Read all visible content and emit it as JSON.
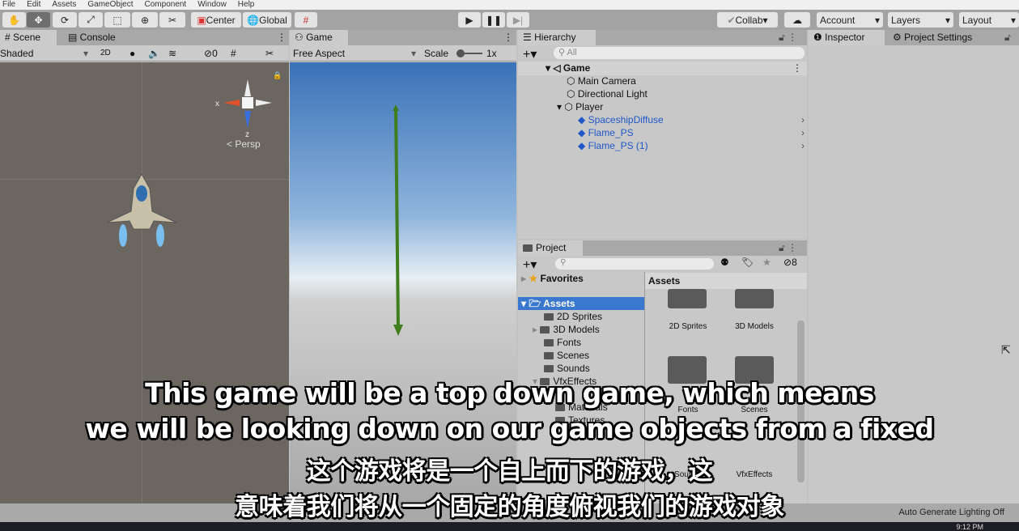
{
  "menu": [
    "File",
    "Edit",
    "Assets",
    "GameObject",
    "Component",
    "Window",
    "Help"
  ],
  "toolbar": {
    "tools": [
      "hand-icon",
      "move-icon",
      "rotate-icon",
      "scale-icon",
      "rect-icon",
      "transform-icon",
      "custom-tool-icon"
    ],
    "center": "Center",
    "global": "Global",
    "collab": "Collab",
    "account": "Account",
    "layers": "Layers",
    "layout": "Layout"
  },
  "scene": {
    "tab": "Scene",
    "console_tab": "Console",
    "shading": "Shaded",
    "mode2d": "2D",
    "hidden_count": "0",
    "gizmo_x": "x",
    "gizmo_z": "z",
    "persp": "Persp"
  },
  "game": {
    "tab": "Game",
    "aspect": "Free Aspect",
    "scale_label": "Scale",
    "scale_value": "1x"
  },
  "hierarchy": {
    "tab": "Hierarchy",
    "search_placeholder": "All",
    "scene": "Game",
    "items": [
      {
        "label": "Main Camera"
      },
      {
        "label": "Directional Light"
      },
      {
        "label": "Player"
      },
      {
        "label": "SpaceshipDiffuse"
      },
      {
        "label": "Flame_PS"
      },
      {
        "label": "Flame_PS (1)"
      }
    ]
  },
  "project": {
    "tab": "Project",
    "hidden_count": "8",
    "favorites": "Favorites",
    "root": "Assets",
    "folders": [
      "2D Sprites",
      "3D Models",
      "Fonts",
      "Scenes",
      "Sounds",
      "VfxEffects",
      "Materials",
      "Textures"
    ],
    "grid_header": "Assets",
    "grid_items": [
      "2D Sprites",
      "3D Models",
      "Fonts",
      "Scenes",
      "Sounds",
      "VfxEffects"
    ]
  },
  "inspector": {
    "tab": "Inspector",
    "settings_tab": "Project Settings"
  },
  "status": {
    "lighting": "Auto Generate Lighting Off",
    "clock": "9:12 PM"
  },
  "subtitles": [
    "This game will be a top down game, which means",
    "we will be looking down on our game objects from a fixed",
    "这个游戏将是一个自上而下的游戏，这",
    "意味着我们将从一个固定的角度俯视我们的游戏对象"
  ]
}
